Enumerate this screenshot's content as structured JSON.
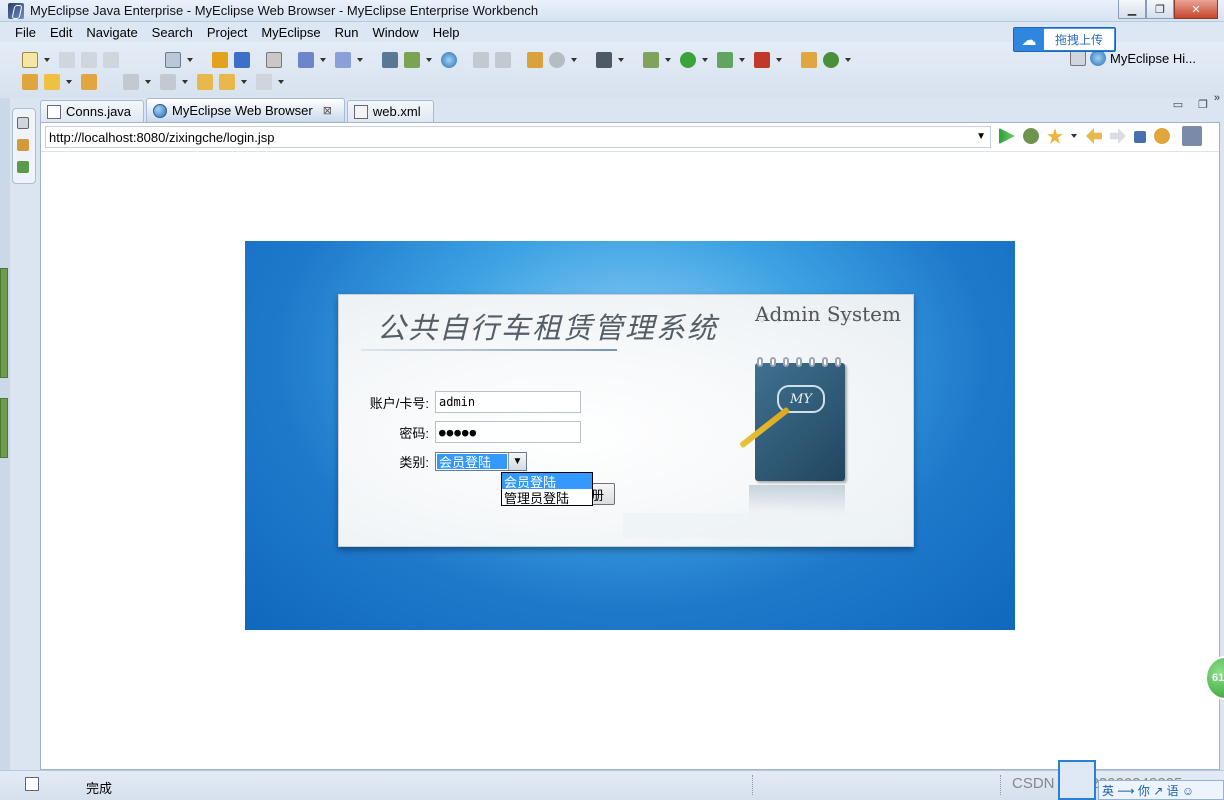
{
  "window": {
    "title": "MyEclipse Java Enterprise - MyEclipse Web Browser - MyEclipse Enterprise Workbench",
    "min": "▁",
    "max": "❐",
    "close": "✕"
  },
  "menu": {
    "items": [
      "File",
      "Edit",
      "Navigate",
      "Search",
      "Project",
      "MyEclipse",
      "Run",
      "Window",
      "Help"
    ]
  },
  "toolbar": {
    "perspective_label": "MyEclipse Hi...",
    "baidu_label": "拖拽上传",
    "more": "»"
  },
  "tabs": [
    {
      "label": "Conns.java",
      "icon": "java-file-icon"
    },
    {
      "label": "MyEclipse Web Browser",
      "icon": "globe-icon",
      "close": "⊠"
    },
    {
      "label": "web.xml",
      "icon": "xml-file-icon"
    }
  ],
  "browser": {
    "url": "http://localhost:8080/zixingche/login.jsp"
  },
  "login": {
    "title": "公共自行车租赁管理系统",
    "admin_title": "Admin System",
    "account_label": "账户/卡号:",
    "account_value": "admin",
    "password_label": "密码:",
    "password_value": "●●●●●",
    "type_label": "类别:",
    "type_selected": "会员登陆",
    "type_options": [
      "会员登陆",
      "管理员登陆"
    ],
    "register_button": "册",
    "notebook_tag": "MY"
  },
  "float_ball": {
    "text": "61"
  },
  "status": {
    "text": "完成",
    "watermark": "CSDN @0023920348225",
    "ime_text": "英 ⟶ 你 ↗ 语 ☺"
  }
}
